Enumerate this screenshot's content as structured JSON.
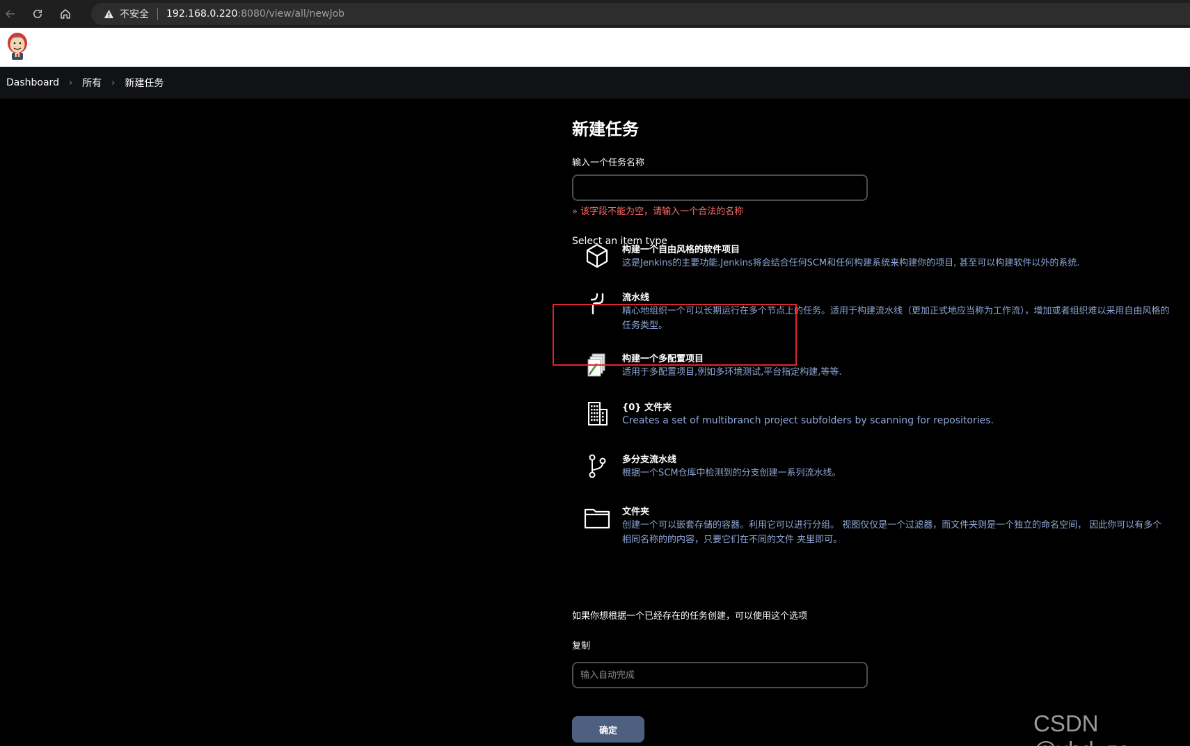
{
  "browser": {
    "security_label": "不安全",
    "url_host": "192.168.0.220",
    "url_path": ":8080/view/all/newJob",
    "icons": [
      "back-icon",
      "reload-icon",
      "home-icon",
      "warning-icon"
    ]
  },
  "breadcrumb": {
    "items": [
      "Dashboard",
      "所有",
      "新建任务"
    ]
  },
  "form": {
    "title": "新建任务",
    "name_label": "输入一个任务名称",
    "name_value": "",
    "error": "» 该字段不能为空，请输入一个合法的名称",
    "select_type_label": "Select an item type"
  },
  "items": [
    {
      "icon": "package-icon",
      "title": "构建一个自由风格的软件项目",
      "desc": "这是Jenkins的主要功能.Jenkins将会结合任何SCM和任何构建系统来构建你的项目, 甚至可以构建软件以外的系统."
    },
    {
      "icon": "pipeline-icon",
      "title": "流水线",
      "desc": "精心地组织一个可以长期运行在多个节点上的任务。适用于构建流水线（更加正式地应当称为工作流），增加或者组织难以采用自由风格的任务类型。"
    },
    {
      "icon": "multi-config-icon",
      "title": "构建一个多配置项目",
      "desc": "适用于多配置项目,例如多环境测试,平台指定构建,等等."
    },
    {
      "icon": "building-icon",
      "title": "{0} 文件夹",
      "desc": "Creates a set of multibranch project subfolders by scanning for repositories."
    },
    {
      "icon": "branch-icon",
      "title": "多分支流水线",
      "desc": "根据一个SCM仓库中检测到的分支创建一系列流水线。"
    },
    {
      "icon": "folder-icon",
      "title": "文件夹",
      "desc": "创建一个可以嵌套存储的容器。利用它可以进行分组。 视图仅仅是一个过滤器，而文件夹则是一个独立的命名空间， 因此你可以有多个相同名称的的内容，只要它们在不同的文件 夹里即可。"
    }
  ],
  "copy": {
    "hint": "如果你想根据一个已经存在的任务创建，可以使用这个选项",
    "label": "复制",
    "placeholder": "输入自动完成"
  },
  "submit_label": "确定",
  "watermark": "CSDN @xbd_zc",
  "colors": {
    "error": "#ff6b6b",
    "desc": "#8fa8d8",
    "highlight": "#e0262b",
    "button": "#4e6080"
  }
}
